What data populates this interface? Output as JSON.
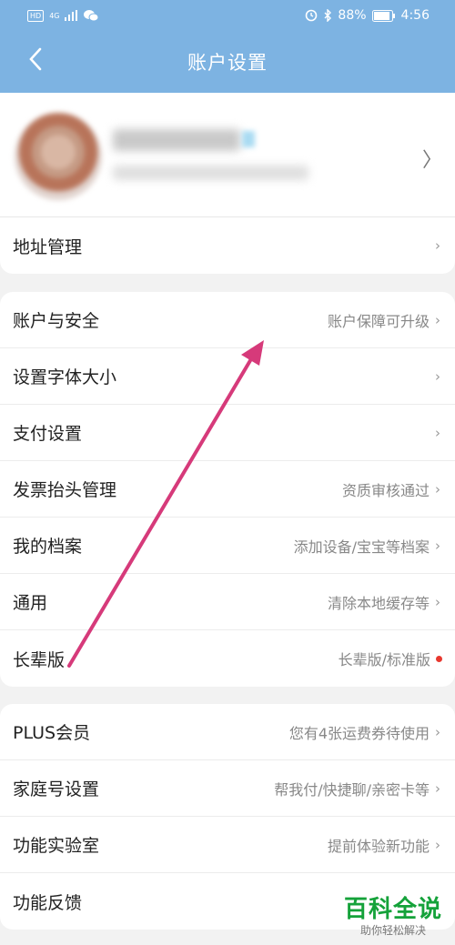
{
  "status_bar": {
    "left_badge": "HD",
    "network": "4G",
    "battery": "88%",
    "time": "4:56"
  },
  "nav": {
    "title": "账户设置"
  },
  "address": {
    "label": "地址管理"
  },
  "group1": [
    {
      "label": "账户与安全",
      "value": "账户保障可升级"
    },
    {
      "label": "设置字体大小",
      "value": ""
    },
    {
      "label": "支付设置",
      "value": ""
    },
    {
      "label": "发票抬头管理",
      "value": "资质审核通过"
    },
    {
      "label": "我的档案",
      "value": "添加设备/宝宝等档案"
    },
    {
      "label": "通用",
      "value": "清除本地缓存等"
    },
    {
      "label": "长辈版",
      "value": "长辈版/标准版"
    }
  ],
  "group2": [
    {
      "label": "PLUS会员",
      "value": "您有4张运费券待使用"
    },
    {
      "label": "家庭号设置",
      "value": "帮我付/快捷聊/亲密卡等"
    },
    {
      "label": "功能实验室",
      "value": "提前体验新功能"
    },
    {
      "label": "功能反馈",
      "value": ""
    }
  ],
  "watermark": {
    "main": "百科全说",
    "sub": "助你轻松解决"
  },
  "colors": {
    "header": "#7db3e2",
    "arrow": "#d63a7a",
    "badge_dot": "#e8382f",
    "watermark": "#15a23a"
  }
}
